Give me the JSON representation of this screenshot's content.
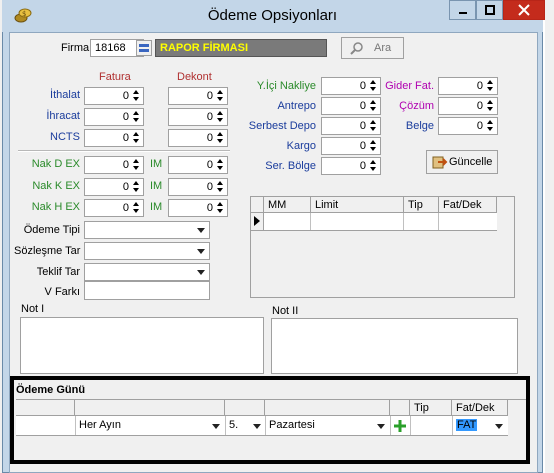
{
  "window": {
    "title": "Ödeme Opsiyonları"
  },
  "firma": {
    "label": "Firma",
    "code": "18168",
    "name": "RAPOR FİRMASI",
    "search_label": "Ara"
  },
  "left_panel": {
    "headers": {
      "fatura": "Fatura",
      "dekont": "Dekont"
    },
    "rows": [
      {
        "label": "İthalat",
        "fatura": "0",
        "dekont": "0"
      },
      {
        "label": "İhracat",
        "fatura": "0",
        "dekont": "0"
      },
      {
        "label": "NCTS",
        "fatura": "0",
        "dekont": "0"
      }
    ],
    "nak_rows": [
      {
        "label": "Nak D EX",
        "value": "0",
        "im_label": "IM",
        "im_value": "0"
      },
      {
        "label": "Nak K EX",
        "value": "0",
        "im_label": "IM",
        "im_value": "0"
      },
      {
        "label": "Nak H EX",
        "value": "0",
        "im_label": "IM",
        "im_value": "0"
      }
    ],
    "combos": [
      {
        "label": "Ödeme Tipi",
        "value": ""
      },
      {
        "label": "Sözleşme Tar",
        "value": ""
      },
      {
        "label": "Teklif Tar",
        "value": ""
      }
    ],
    "v_farki": {
      "label": "V Farkı",
      "value": ""
    }
  },
  "right_panel": {
    "fields": [
      {
        "label": "Y.İçi Nakliye",
        "value": "0"
      },
      {
        "label": "Antrepo",
        "value": "0"
      },
      {
        "label": "Serbest Depo",
        "value": "0"
      },
      {
        "label": "Kargo",
        "value": "0"
      },
      {
        "label": "Ser. Bölge",
        "value": "0"
      }
    ],
    "fields2": [
      {
        "label": "Gider Fat.",
        "value": "0"
      },
      {
        "label": "Çözüm",
        "value": "0"
      },
      {
        "label": "Belge",
        "value": "0"
      }
    ],
    "guncelle_label": "Güncelle",
    "grid": {
      "columns": [
        "MM",
        "Limit",
        "Tip",
        "Fat/Dek"
      ]
    }
  },
  "notes": {
    "not1_label": "Not I",
    "not2_label": "Not II"
  },
  "odeme_gunu": {
    "title": "Ödeme Günü",
    "columns": [
      "",
      "",
      "",
      "",
      "",
      "Tip",
      "Fat/Dek"
    ],
    "row": {
      "period": "Her Ayın",
      "day": "5.",
      "weekday": "Pazartesi",
      "tip": "",
      "fat_dek": "FAT"
    }
  },
  "colors": {
    "window_frame": "#c3d6e8",
    "close_button": "#c42b1c",
    "firma_name_bg": "#7a7a7a",
    "firma_name_text": "#ffff00",
    "highlight_box": "#000000"
  }
}
